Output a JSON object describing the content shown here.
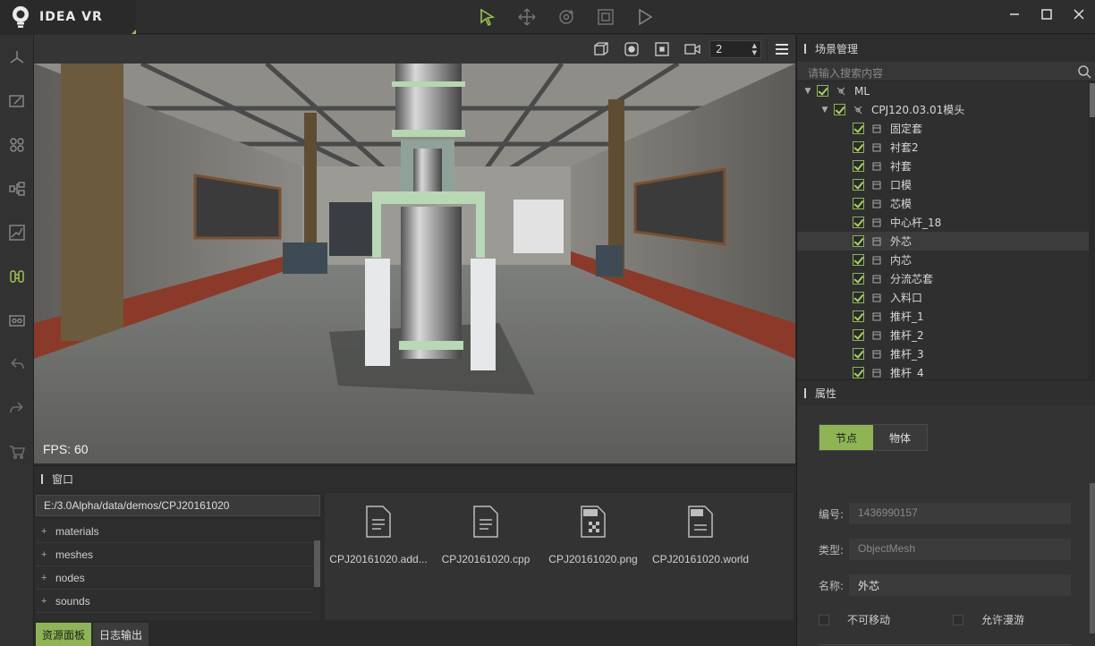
{
  "app": {
    "title": "IDEA VR"
  },
  "toolbar": {
    "tools": [
      "select-tool-icon",
      "move-tool-icon",
      "rotate-tool-icon",
      "scale-tool-icon",
      "play-icon"
    ]
  },
  "window_controls": [
    "minimize-icon",
    "maximize-icon",
    "close-icon"
  ],
  "sidebar": {
    "items": [
      "axis-icon",
      "edit-icon",
      "components-icon",
      "hierarchy-icon",
      "chart-icon",
      "physics-icon",
      "media-icon",
      "undo-icon",
      "redo-icon",
      "store-icon"
    ]
  },
  "viewport": {
    "camera_count": "2",
    "fps_label": "FPS: 60"
  },
  "window_panel": {
    "title": "窗口",
    "path": "E:/3.0Alpha/data/demos/CPJ20161020",
    "folders": [
      "materials",
      "meshes",
      "nodes",
      "sounds"
    ],
    "files": [
      {
        "name": "CPJ20161020.add...",
        "icon": "file-icon"
      },
      {
        "name": "CPJ20161020.cpp",
        "icon": "file-icon"
      },
      {
        "name": "CPJ20161020.png",
        "icon": "png-file-icon"
      },
      {
        "name": "CPJ20161020.world",
        "icon": "world-file-icon"
      }
    ]
  },
  "bottom_tabs": [
    "资源面板",
    "日志输出"
  ],
  "scene": {
    "title": "场景管理",
    "search_placeholder": "请输入搜索内容",
    "root": "ML",
    "group": "CPJ120.03.01模头",
    "items": [
      "固定套",
      "衬套2",
      "衬套",
      "口模",
      "芯模",
      "中心杆_18",
      "外芯",
      "内芯",
      "分流芯套",
      "入料口",
      "推杆_1",
      "推杆_2",
      "推杆_3",
      "推杆_4"
    ],
    "selected": "外芯"
  },
  "properties": {
    "title": "属性",
    "tabs": [
      "节点",
      "物体"
    ],
    "id_label": "编号:",
    "id_value": "1436990157",
    "type_label": "类型:",
    "type_value": "ObjectMesh",
    "name_label": "名称:",
    "name_value": "外芯",
    "immovable_label": "不可移动",
    "roam_label": "允许漫游"
  },
  "colors": {
    "accent": "#8fb454",
    "background": "#2b2b2b"
  }
}
